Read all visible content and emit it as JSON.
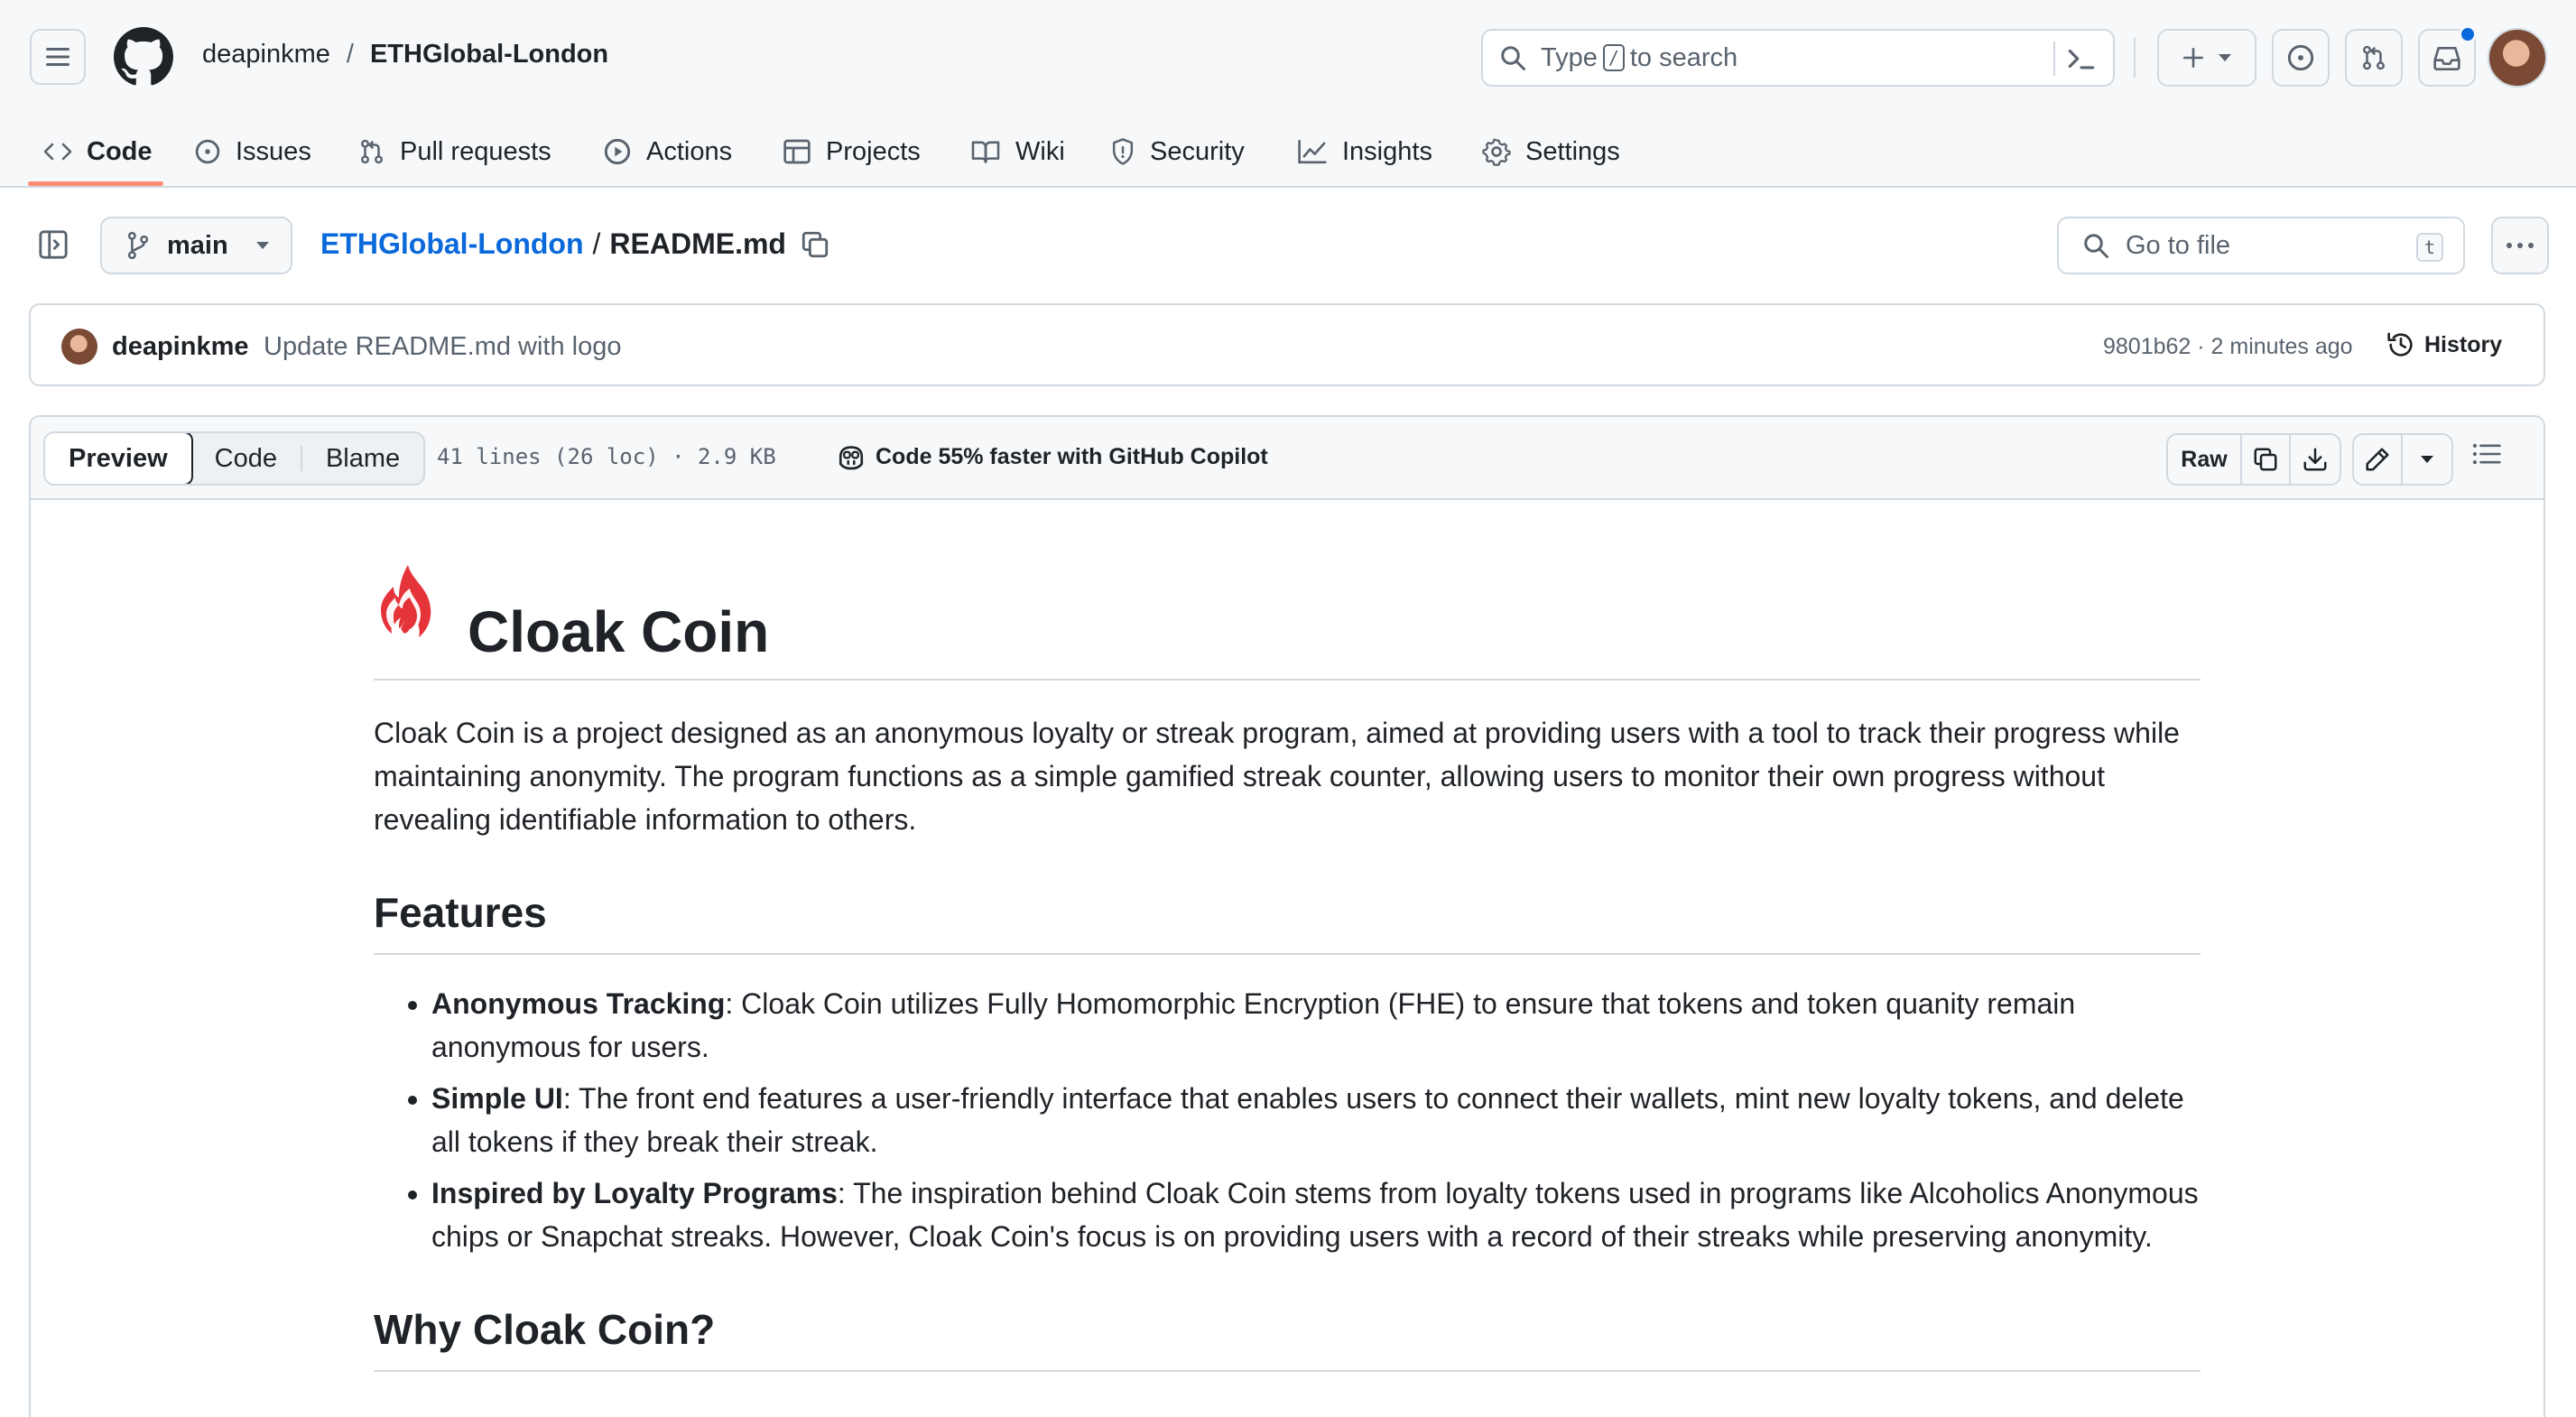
{
  "header": {
    "owner": "deapinkme",
    "separator": "/",
    "repo": "ETHGlobal-London",
    "search_prefix": "Type",
    "search_key": "/",
    "search_suffix": "to search"
  },
  "tabs": [
    {
      "label": "Code"
    },
    {
      "label": "Issues"
    },
    {
      "label": "Pull requests"
    },
    {
      "label": "Actions"
    },
    {
      "label": "Projects"
    },
    {
      "label": "Wiki"
    },
    {
      "label": "Security"
    },
    {
      "label": "Insights"
    },
    {
      "label": "Settings"
    }
  ],
  "filebar": {
    "branch": "main",
    "repo_link": "ETHGlobal-London",
    "path_sep": "/",
    "filename": "README.md",
    "goto_placeholder": "Go to file",
    "goto_key": "t"
  },
  "commit": {
    "author": "deapinkme",
    "message": "Update README.md with logo",
    "meta": "9801b62 · 2 minutes ago",
    "history_label": "History"
  },
  "fileview": {
    "modes": [
      "Preview",
      "Code",
      "Blame"
    ],
    "info": "41 lines (26 loc) · 2.9 KB",
    "copilot": "Code 55% faster with GitHub Copilot",
    "raw": "Raw"
  },
  "readme": {
    "title": "Cloak Coin",
    "intro": "Cloak Coin is a project designed as an anonymous loyalty or streak program, aimed at providing users with a tool to track their progress while maintaining anonymity. The program functions as a simple gamified streak counter, allowing users to monitor their own progress without revealing identifiable information to others.",
    "features_heading": "Features",
    "features": [
      {
        "term": "Anonymous Tracking",
        "text": ": Cloak Coin utilizes Fully Homomorphic Encryption (FHE) to ensure that tokens and token quanity remain anonymous for users."
      },
      {
        "term": "Simple UI",
        "text": ": The front end features a user-friendly interface that enables users to connect their wallets, mint new loyalty tokens, and delete all tokens if they break their streak."
      },
      {
        "term": "Inspired by Loyalty Programs",
        "text": ": The inspiration behind Cloak Coin stems from loyalty tokens used in programs like Alcoholics Anonymous chips or Snapchat streaks. However, Cloak Coin's focus is on providing users with a record of their streaks while preserving anonymity."
      }
    ],
    "why_heading": "Why Cloak Coin?"
  },
  "colors": {
    "accent_link": "#0969da",
    "tab_underline": "#fd8c73",
    "flame": "#e5333a"
  },
  "icons": [
    "hamburger-icon",
    "github-logo-icon",
    "search-icon",
    "terminal-icon",
    "plus-icon",
    "issue-icon",
    "pull-request-icon",
    "inbox-icon",
    "code-icon",
    "play-icon",
    "table-icon",
    "book-icon",
    "shield-icon",
    "graph-icon",
    "gear-icon",
    "sidebar-icon",
    "branch-icon",
    "copy-icon",
    "clock-icon",
    "copilot-icon",
    "download-icon",
    "pencil-icon",
    "list-icon",
    "flame-icon"
  ]
}
